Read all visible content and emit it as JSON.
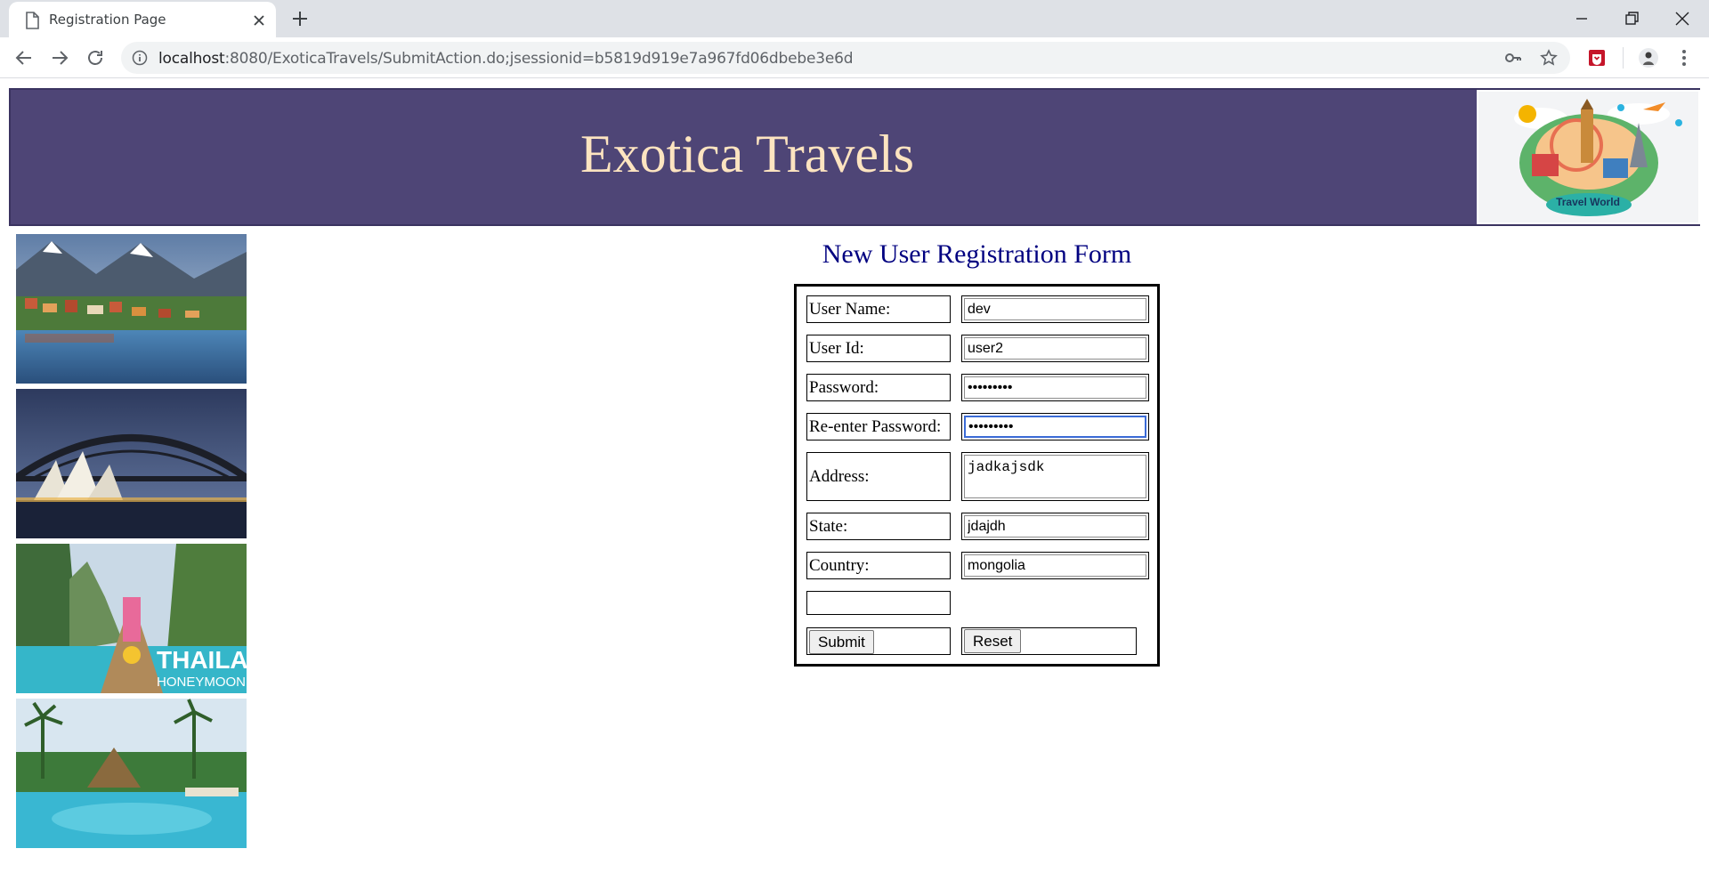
{
  "browser": {
    "tab_title": "Registration Page",
    "url_host": "localhost",
    "url_rest": ":8080/ExoticaTravels/SubmitAction.do;jsessionid=b5819d919e7a967fd06dbebe3e6d"
  },
  "header": {
    "title": "Exotica Travels",
    "logo_text": "Travel World"
  },
  "sidebar_images": [
    "mountain-lake-village-photo",
    "sydney-opera-house-photo",
    "thailand-honeymoon-photo",
    "tropical-resort-pool-photo"
  ],
  "thailand_caption": "THAILAND",
  "thailand_sub": "HONEYMOON",
  "form": {
    "title": "New User Registration Form",
    "fields": {
      "username": {
        "label": "User Name:",
        "value": "dev"
      },
      "userid": {
        "label": "User Id:",
        "value": "user2"
      },
      "password": {
        "label": "Password:",
        "value": "•••••••••"
      },
      "repassword": {
        "label": "Re-enter Password:",
        "value": "•••••••••"
      },
      "address": {
        "label": "Address:",
        "value": "jadkajsdk"
      },
      "state": {
        "label": "State:",
        "value": "jdajdh"
      },
      "country": {
        "label": "Country:",
        "value": "mongolia"
      }
    },
    "submit_label": "Submit",
    "reset_label": "Reset"
  },
  "colors": {
    "banner_bg": "#4e4576",
    "banner_text": "#fde4c0",
    "form_title": "#000080"
  }
}
